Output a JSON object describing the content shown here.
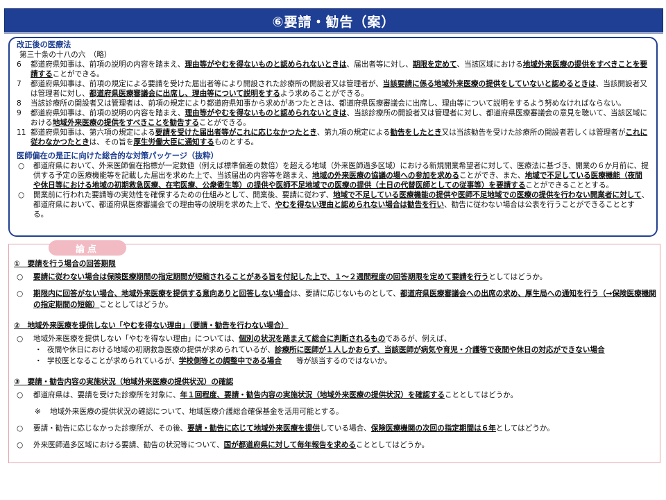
{
  "title": "⑥要請・勧告（案）",
  "law": {
    "heading": "改正後の医療法",
    "article": "第三十条の十八の六　（略）",
    "paras": [
      {
        "num": "6",
        "parts": [
          {
            "t": "都道府県知事は、前項の説明の内容を踏まえ、"
          },
          {
            "t": "理由等がやむを得ないものと認められないときは",
            "s": "bu"
          },
          {
            "t": "、届出者等に対し、"
          },
          {
            "t": "期限を定めて",
            "s": "bu"
          },
          {
            "t": "、当該区域における"
          },
          {
            "t": "地域外来医療の提供をすべきことを要請する",
            "s": "bu"
          },
          {
            "t": "ことができる。"
          }
        ]
      },
      {
        "num": "7",
        "parts": [
          {
            "t": "都道府県知事は、前項の規定による要請を受けた届出者等により開設された診療所の開設者又は管理者が、"
          },
          {
            "t": "当該要請に係る地域外来医療の提供をしていないと認めるときは",
            "s": "bu"
          },
          {
            "t": "、当該開設者又は管理者に対し、"
          },
          {
            "t": "都道府県医療審議会に出席し、理由等について説明をする",
            "s": "bu"
          },
          {
            "t": "よう求めることができる。"
          }
        ]
      },
      {
        "num": "8",
        "parts": [
          {
            "t": "当該診療所の開設者又は管理者は、前項の規定により都道府県知事から求めがあつたときは、都道府県医療審議会に出席し、理由等について説明をするよう努めなければならない。"
          }
        ]
      },
      {
        "num": "9",
        "parts": [
          {
            "t": "都道府県知事は、前項の説明の内容を踏まえ、"
          },
          {
            "t": "理由等がやむを得ないものと認められないときは",
            "s": "bu"
          },
          {
            "t": "、当該診療所の開設者又は管理者に対し、都道府県医療審議会の意見を聴いて、当該区域における"
          },
          {
            "t": "地域外来医療の提供をすべきことを勧告する",
            "s": "bu"
          },
          {
            "t": "ことができる。"
          }
        ]
      },
      {
        "num": "11",
        "parts": [
          {
            "t": "都道府県知事は、第六項の規定による"
          },
          {
            "t": "要請を受けた届出者等がこれに応じなかつたとき",
            "s": "bu"
          },
          {
            "t": "、第九項の規定による"
          },
          {
            "t": "勧告をしたとき",
            "s": "bu"
          },
          {
            "t": "又は当該勧告を受けた診療所の開設者若しくは管理者が"
          },
          {
            "t": "これに従わなかつたとき",
            "s": "bu"
          },
          {
            "t": "は、その旨を"
          },
          {
            "t": "厚生労働大臣に通知する",
            "s": "bu"
          },
          {
            "t": "ものとする。"
          }
        ]
      }
    ],
    "package_heading": "医師偏在の是正に向けた総合的な対策パッケージ（抜粋）",
    "package_items": [
      {
        "bullet": "○",
        "parts": [
          {
            "t": "都道府県において、外来医師偏在指標が一定数値（例えば標準偏差の数倍）を超える地域（外来医師過多区域）における新規開業希望者に対して、医療法に基づき、開業の６か月前に、提供する予定の医療機能等を記載した届出を求めた上で、当該届出の内容等を踏まえ、"
          },
          {
            "t": "地域の外来医療の協議の場への参加を求める",
            "s": "bu"
          },
          {
            "t": "ことができ、また、"
          },
          {
            "t": "地域で不足している医療機能（夜間や休日等における地域の初期救急医療、在宅医療、公衆衛生等）の提供や医師不足地域での医療の提供（土日の代替医師としての従事等）を要請する",
            "s": "bu"
          },
          {
            "t": "ことができることとする。"
          }
        ]
      },
      {
        "bullet": "○",
        "parts": [
          {
            "t": "開業前に行われた要請等の実効性を確保するための仕組みとして、開業後、要請に従わず、"
          },
          {
            "t": "地域で不足している医療機能の提供や医師不足地域での医療の提供を行わない開業者に対して",
            "s": "bu"
          },
          {
            "t": "、都道府県において、都道府県医療審議会での理由等の説明を求めた上で、"
          },
          {
            "t": "やむを得ない理由と認められない場合は勧告を行い",
            "s": "bu"
          },
          {
            "t": "、勧告に従わない場合は公表を行うことができることとする。"
          }
        ]
      }
    ]
  },
  "ronten": {
    "tab": "論点",
    "sections": [
      {
        "heading": "①　要請を行う場合の回答期限",
        "items": [
          {
            "type": "circle",
            "mark": "○",
            "parts": [
              {
                "t": "要請に従わない場合は保険医療期間の指定期間が短縮されることがある旨を付記した上で、１～２週間程度の回答期限を定めて要請を行う",
                "s": "bu"
              },
              {
                "t": "としてはどうか。"
              }
            ]
          },
          {
            "type": "circle",
            "mark": "○",
            "parts": [
              {
                "t": "期限内に回答がない場合、地域外来医療を提供する意向ありと回答しない場合",
                "s": "bu"
              },
              {
                "t": "は、要請に応じないものとして、"
              },
              {
                "t": "都道府県医療審議会への出席の求め、厚生局への通知を行う（→保険医療機関の指定期間の短縮）",
                "s": "bu"
              },
              {
                "t": "こととしてはどうか。"
              }
            ]
          }
        ]
      },
      {
        "heading": "②　地域外来医療を提供しない「やむを得ない理由」（要請・勧告を行わない場合）",
        "items": [
          {
            "type": "circle",
            "mark": "○",
            "parts": [
              {
                "t": "地域外来医療を提供しない「やむを得ない理由」については、"
              },
              {
                "t": "個別の状況を踏まえて総合に判断されるもの",
                "s": "bu"
              },
              {
                "t": "であるが、例えば、"
              }
            ]
          },
          {
            "type": "dot",
            "mark": "・",
            "parts": [
              {
                "t": "夜間や休日における地域の初期救急医療の提供が求められているが、"
              },
              {
                "t": "診療所に医師が１人しかおらず、当該医師が病気や育児・介護等で夜間や休日の対応ができない場合",
                "s": "bu"
              }
            ]
          },
          {
            "type": "dot",
            "mark": "・",
            "parts": [
              {
                "t": "学校医となることが求められているが、"
              },
              {
                "t": "学校側等との調整中である場合",
                "s": "bu"
              },
              {
                "t": "　　等が該当するのではないか。"
              }
            ]
          }
        ]
      },
      {
        "heading": "③　要請・勧告内容の実施状況（地域外来医療の提供状況）の確認",
        "items": [
          {
            "type": "circle",
            "mark": "○",
            "parts": [
              {
                "t": "都道府県は、要請を受けた診療所を対象に、"
              },
              {
                "t": "年１回程度、要請・勧告内容の実施状況（地域外来医療の提供状況）を確認する",
                "s": "bu"
              },
              {
                "t": "こととしてはどうか。"
              }
            ]
          },
          {
            "type": "note",
            "mark": "※",
            "parts": [
              {
                "t": "地域外来医療の提供状況の確認について、地域医療介護総合確保基金を活用可能とする。"
              }
            ]
          },
          {
            "type": "circle",
            "mark": "○",
            "parts": [
              {
                "t": "要請・勧告に応じなかった診療所が、その後、"
              },
              {
                "t": "要請・勧告に応じて地域外来医療を提供",
                "s": "bu"
              },
              {
                "t": "している場合、"
              },
              {
                "t": "保険医療機関の次回の指定期間は６年",
                "s": "bu"
              },
              {
                "t": "としてはどうか。"
              }
            ]
          },
          {
            "type": "circle",
            "mark": "○",
            "parts": [
              {
                "t": "外来医師過多区域における要請、勧告の状況等について、"
              },
              {
                "t": "国が都道府県に対して毎年報告を求める",
                "s": "bu"
              },
              {
                "t": "こととしてはどうか。"
              }
            ]
          }
        ]
      }
    ]
  }
}
